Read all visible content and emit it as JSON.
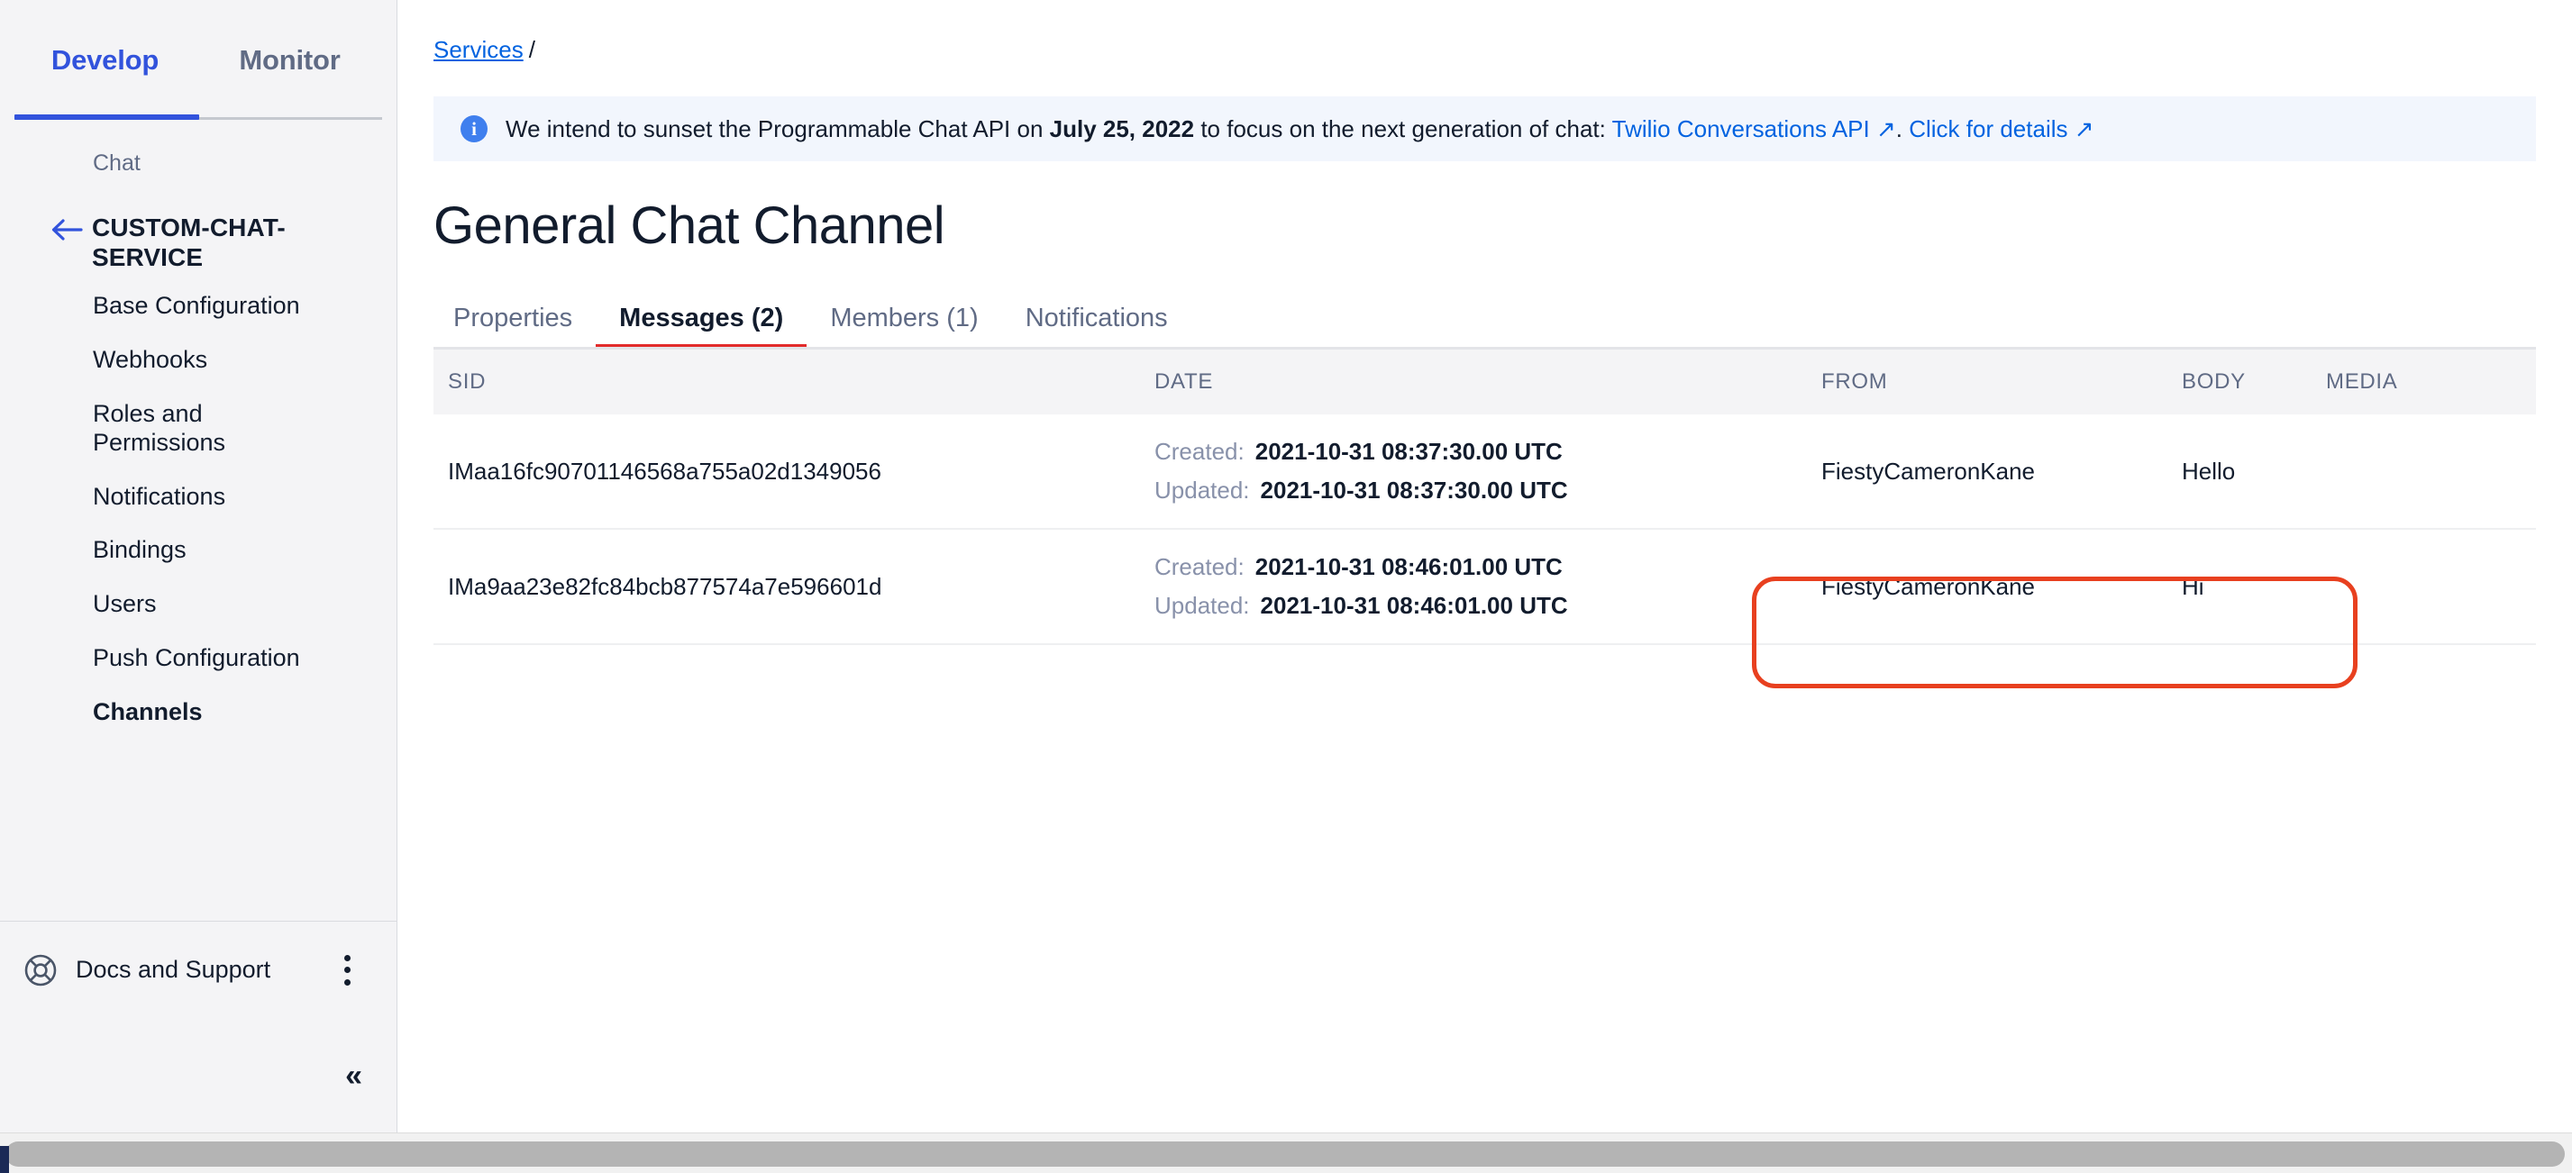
{
  "sidebar": {
    "segmented_tabs": [
      {
        "label": "Develop",
        "active": true
      },
      {
        "label": "Monitor",
        "active": false
      }
    ],
    "group_label": "Chat",
    "back_icon": "arrow-left-icon",
    "service_name": "CUSTOM-CHAT-SERVICE",
    "items": [
      {
        "label": "Base Configuration",
        "selected": false
      },
      {
        "label": "Webhooks",
        "selected": false
      },
      {
        "label": "Roles and Permissions",
        "selected": false
      },
      {
        "label": "Notifications",
        "selected": false
      },
      {
        "label": "Bindings",
        "selected": false
      },
      {
        "label": "Users",
        "selected": false
      },
      {
        "label": "Push Configuration",
        "selected": false
      },
      {
        "label": "Channels",
        "selected": true
      }
    ],
    "footer": {
      "icon": "lifebuoy-icon",
      "label": "Docs and Support",
      "menu_icon": "kebab-menu-icon"
    },
    "collapse_icon": "chevron-double-left-icon",
    "collapse_label": "«"
  },
  "breadcrumb": {
    "link": "Services",
    "separator": "/"
  },
  "banner": {
    "icon": "info-icon",
    "icon_glyph": "i",
    "text_before": "We intend to sunset the Programmable Chat API on ",
    "date": "July 25, 2022",
    "text_middle": " to focus on the next generation of chat: ",
    "link1": "Twilio Conversations API ↗",
    "text_between_links": ". ",
    "link2": "Click for details ↗",
    "background": "#f2f6fd",
    "link_color": "#0263e0"
  },
  "page": {
    "title": "General Chat Channel"
  },
  "tabs": [
    {
      "label": "Properties",
      "active": false
    },
    {
      "label": "Messages (2)",
      "active": true
    },
    {
      "label": "Members (1)",
      "active": false
    },
    {
      "label": "Notifications",
      "active": false
    }
  ],
  "table": {
    "columns": [
      "SID",
      "DATE",
      "FROM",
      "BODY",
      "MEDIA"
    ],
    "date_keys": {
      "created": "Created:",
      "updated": "Updated:"
    },
    "rows": [
      {
        "sid": "IMaa16fc90701146568a755a02d1349056",
        "created": "2021-10-31 08:37:30.00 UTC",
        "updated": "2021-10-31 08:37:30.00 UTC",
        "from": "FiestyCameronKane",
        "body": "Hello",
        "media": ""
      },
      {
        "sid": "IMa9aa23e82fc84bcb877574a7e596601d",
        "created": "2021-10-31 08:46:01.00 UTC",
        "updated": "2021-10-31 08:46:01.00 UTC",
        "from": "FiestyCameronKane",
        "body": "Hi",
        "media": ""
      }
    ]
  },
  "annotation": {
    "color": "#e8401f",
    "target": "row-2-from-body"
  },
  "colors": {
    "accent_blue": "#3253dc",
    "link_blue": "#0263e0",
    "tab_red": "#e22b2b",
    "sidebar_bg": "#f4f4f6",
    "text_dark": "#121c2d",
    "text_muted": "#606b85"
  }
}
